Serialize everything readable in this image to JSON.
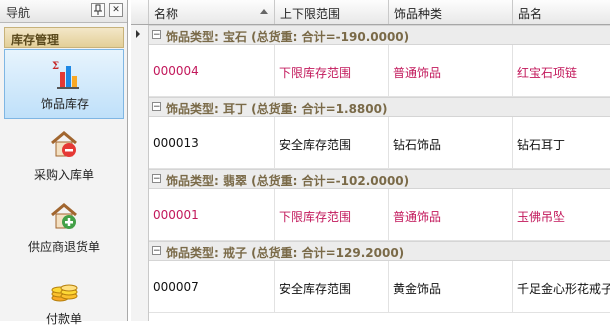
{
  "nav": {
    "title": "导航",
    "pin_icon": "pin-icon",
    "close_icon": "close-icon",
    "group_title": "库存管理",
    "items": [
      {
        "label": "饰品库存",
        "icon": "bar-chart-icon",
        "active": true
      },
      {
        "label": "采购入库单",
        "icon": "house-minus-icon",
        "active": false
      },
      {
        "label": "供应商退货单",
        "icon": "house-plus-icon",
        "active": false
      },
      {
        "label": "付款单",
        "icon": "coins-icon",
        "active": false
      }
    ]
  },
  "grid": {
    "columns": [
      "名称",
      "上下限范围",
      "饰品种类",
      "品名"
    ],
    "groups": [
      {
        "label": "饰品类型: 宝石 (总货重: 合计=-190.0000)",
        "row": {
          "code": "000004",
          "range": "下限库存范围",
          "kind": "普通饰品",
          "name": "红宝石项链",
          "warn": true
        }
      },
      {
        "label": "饰品类型: 耳丁 (总货重: 合计=1.8800)",
        "row": {
          "code": "000013",
          "range": "安全库存范围",
          "kind": "钻石饰品",
          "name": "钻石耳丁",
          "warn": false
        }
      },
      {
        "label": "饰品类型: 翡翠 (总货重: 合计=-102.0000)",
        "row": {
          "code": "000001",
          "range": "下限库存范围",
          "kind": "普通饰品",
          "name": "玉佛吊坠",
          "warn": true
        }
      },
      {
        "label": "饰品类型: 戒子 (总货重: 合计=129.2000)",
        "row": {
          "code": "000007",
          "range": "安全库存范围",
          "kind": "黄金饰品",
          "name": "千足金心形花戒子",
          "warn": false
        }
      }
    ]
  },
  "colors": {
    "warn_text": "#c2185b",
    "group_text": "#7a6a48",
    "accent": "#bfe0f9"
  }
}
